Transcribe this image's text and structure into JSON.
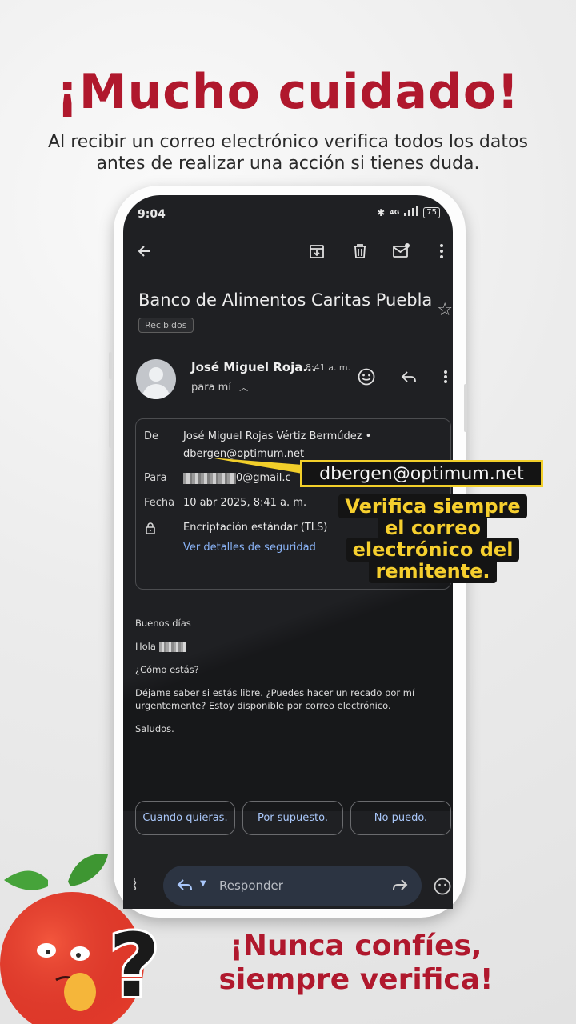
{
  "headline": "¡Mucho cuidado!",
  "subheadline": "Al recibir un correo electrónico verifica todos los datos antes de realizar una acción si tienes duda.",
  "phone": {
    "status": {
      "time": "9:04",
      "network": "4G",
      "battery": "75"
    },
    "toolbar": {
      "back_icon": "arrow-left-icon",
      "archive_icon": "archive-icon",
      "delete_icon": "trash-icon",
      "unread_icon": "mail-unread-icon",
      "more_icon": "more-vertical-icon"
    },
    "email": {
      "subject": "Banco de Alimentos Caritas Puebla",
      "label_chip": "Recibidos",
      "sender_short": "José Miguel Roja...",
      "time": "8:41 a. m.",
      "to_me": "para mí",
      "details": {
        "from_label": "De",
        "from_name": "José Miguel Rojas Vértiz Bermúdez •",
        "from_email": "dbergen@optimum.net",
        "to_label": "Para",
        "to_value_suffix": "0@gmail.c",
        "date_label": "Fecha",
        "date_value": "10 abr 2025, 8:41 a. m.",
        "encryption": "Encriptación estándar (TLS)",
        "security_link": "Ver detalles de seguridad"
      },
      "body": {
        "greeting": "Buenos días",
        "hello": "Hola",
        "how_are_you": "¿Cómo estás?",
        "request": "Déjame saber si estás libre. ¿Puedes hacer un recado por mí urgentemente? Estoy disponible por correo electrónico.",
        "closing": "Saludos."
      },
      "smart_replies": [
        "Cuando quieras.",
        "Por supuesto.",
        "No puedo."
      ],
      "reply_bar": {
        "label": "Responder"
      }
    }
  },
  "callout": {
    "email": "dbergen@optimum.net",
    "note": "Verifica siempre el correo electrónico del remitente."
  },
  "footer": {
    "line1": "¡Nunca confíes,",
    "line2": "siempre verifica!"
  },
  "colors": {
    "brand_red": "#b0182d",
    "highlight_yellow": "#f2cf2a",
    "screen_dark": "#1f2023",
    "link_blue": "#8ab4f8"
  }
}
